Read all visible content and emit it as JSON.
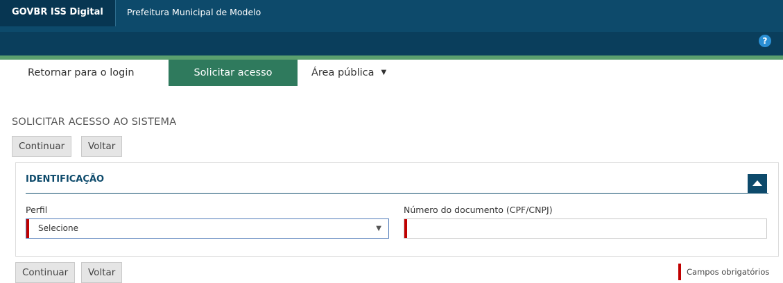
{
  "header": {
    "brand": "GOVBR ISS Digital",
    "organization": "Prefeitura Municipal de Modelo",
    "help_label": "?"
  },
  "nav": {
    "items": [
      {
        "label": "Retornar para o login"
      },
      {
        "label": "Solicitar acesso"
      },
      {
        "label": "Área pública"
      }
    ],
    "active": "Solicitar acesso"
  },
  "page": {
    "title": "SOLICITAR ACESSO AO SISTEMA"
  },
  "buttons": {
    "continue": "Continuar",
    "back": "Voltar"
  },
  "panel": {
    "title": "IDENTIFICAÇÃO",
    "fields": {
      "perfil": {
        "label": "Perfil",
        "value": "Selecione"
      },
      "documento": {
        "label": "Número do documento (CPF/CNPJ)",
        "value": ""
      }
    }
  },
  "legend": {
    "required": "Campos obrigatórios"
  },
  "colors": {
    "header": "#0d4a6b",
    "brand_bg": "#073652",
    "accent_green": "#2f7a5d",
    "required_red": "#c00000"
  }
}
